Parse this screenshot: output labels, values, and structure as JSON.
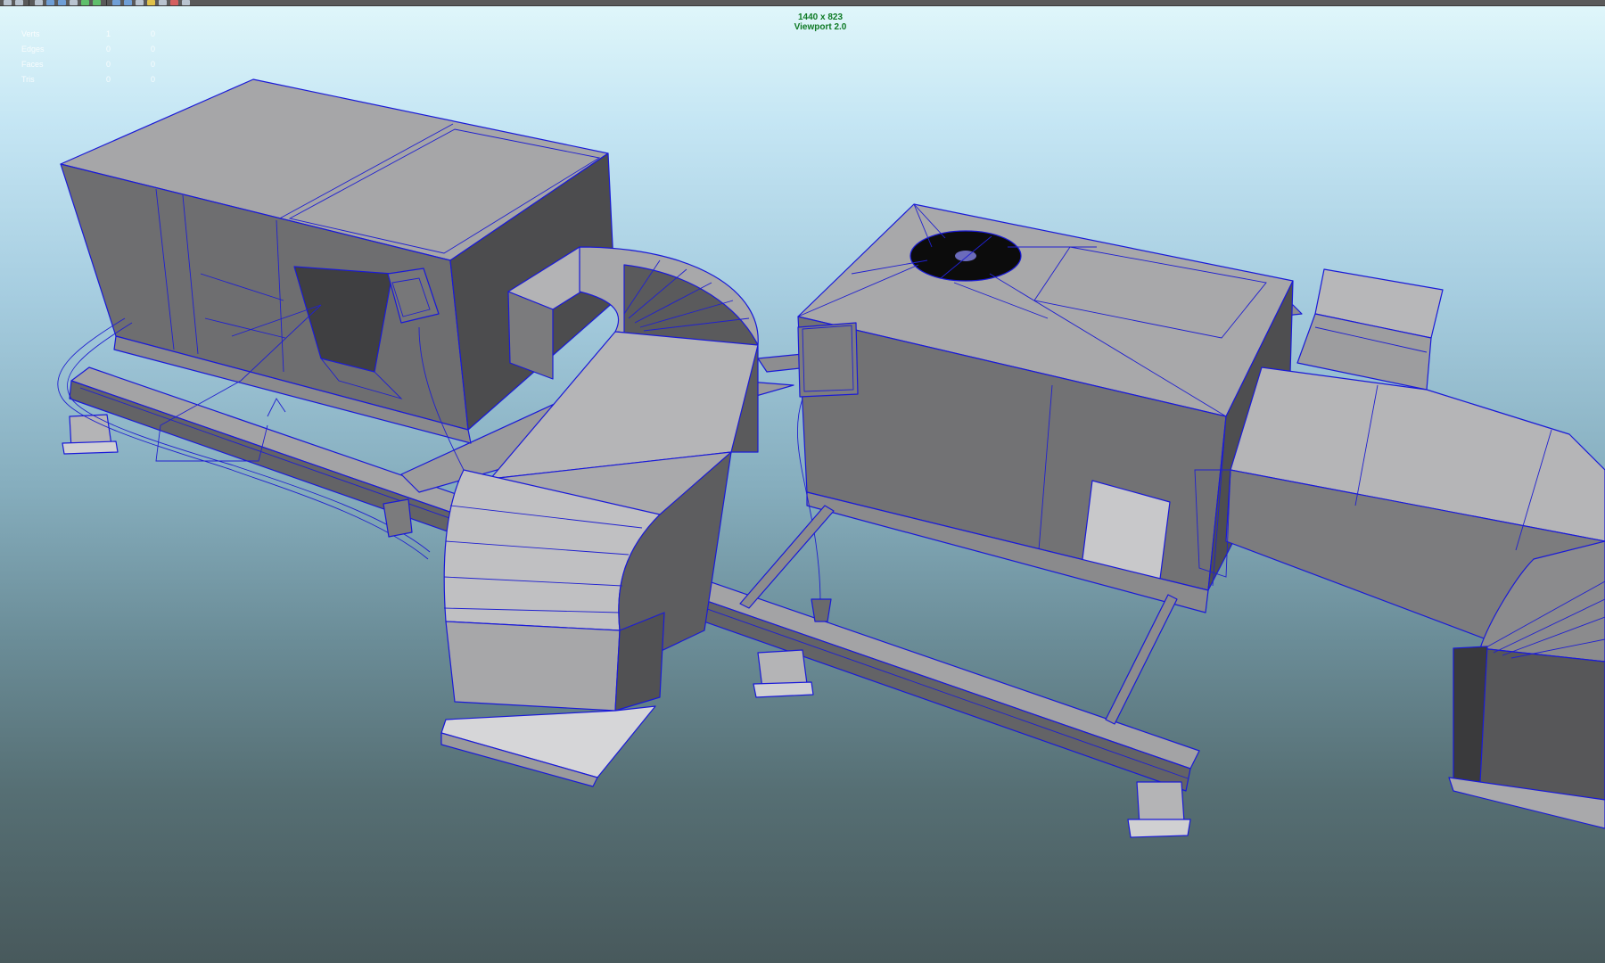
{
  "toolbar": {
    "icons": [
      "move-icon",
      "select-icon",
      "frame-icon",
      "camera-icon",
      "grid-icon",
      "light-icon",
      "shading-icon",
      "texture-icon",
      "shadow-icon",
      "ao-icon",
      "isolate-icon",
      "xray-icon",
      "render-icon",
      "snap-icon"
    ]
  },
  "hud": {
    "resolution": "1440 x 823",
    "renderer": "Viewport 2.0"
  },
  "stats": [
    {
      "label": "Verts",
      "a": "1",
      "b": "0"
    },
    {
      "label": "Edges",
      "a": "0",
      "b": "0"
    },
    {
      "label": "Faces",
      "a": "0",
      "b": "0"
    },
    {
      "label": "Tris",
      "a": "0",
      "b": "0"
    }
  ],
  "colors": {
    "wireframe": "#1a1ad8",
    "hud_text": "#0e7a25",
    "background_top": "#dff6fa",
    "background_bottom": "#48595c"
  }
}
